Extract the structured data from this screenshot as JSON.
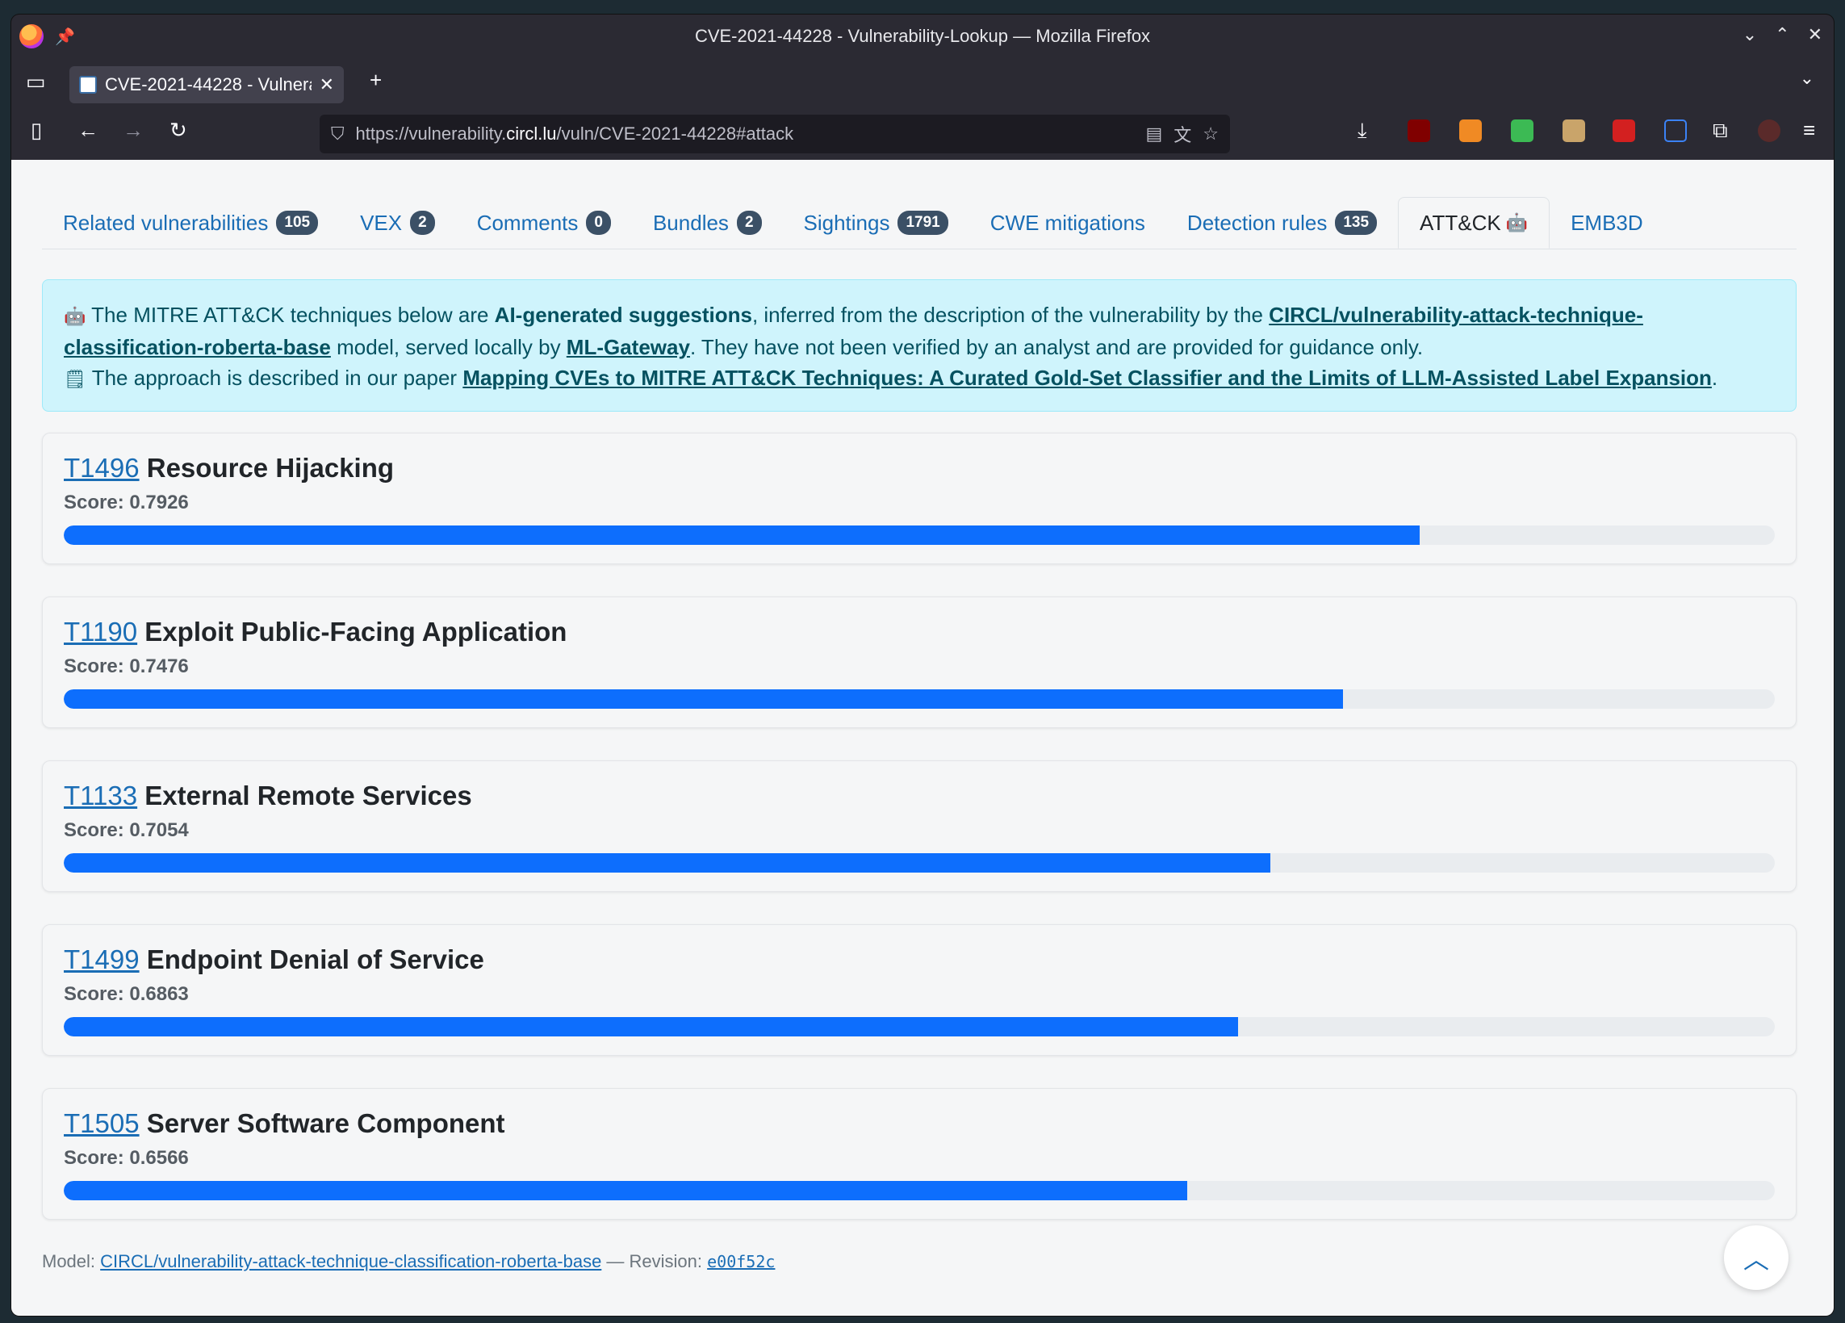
{
  "window": {
    "title": "CVE-2021-44228 - Vulnerability-Lookup — Mozilla Firefox"
  },
  "browser_tab": {
    "label": "CVE-2021-44228 - Vulnerab",
    "close": "✕",
    "new": "+"
  },
  "urlbar": {
    "prefix": "https://vulnerability.",
    "host": "circl.lu",
    "path": "/vuln/CVE-2021-44228#attack"
  },
  "page_tabs": [
    {
      "label": "Related vulnerabilities",
      "badge": "105"
    },
    {
      "label": "VEX",
      "badge": "2"
    },
    {
      "label": "Comments",
      "badge": "0"
    },
    {
      "label": "Bundles",
      "badge": "2"
    },
    {
      "label": "Sightings",
      "badge": "1791"
    },
    {
      "label": "CWE mitigations",
      "badge": ""
    },
    {
      "label": "Detection rules",
      "badge": "135"
    },
    {
      "label": "ATT&CK",
      "badge": ""
    },
    {
      "label": "EMB3D",
      "badge": ""
    }
  ],
  "alert": {
    "p1_a": "The MITRE ATT&CK techniques below are ",
    "p1_b": "AI-generated suggestions",
    "p1_c": ", inferred from the description of the vulnerability by the ",
    "p1_model": "CIRCL/vulnerability-attack-technique-classification-roberta-base",
    "p1_d": " model, served locally by ",
    "p1_gateway": "ML-Gateway",
    "p1_e": ". They have not been verified by an analyst and are provided for guidance only.",
    "p2_a": "The approach is described in our paper ",
    "p2_paper": "Mapping CVEs to MITRE ATT&CK Techniques: A Curated Gold-Set Classifier and the Limits of LLM-Assisted Label Expansion",
    "p2_b": "."
  },
  "techniques": [
    {
      "id": "T1496",
      "name": "Resource Hijacking",
      "score_text": "Score: 0.7926",
      "score": 0.7926
    },
    {
      "id": "T1190",
      "name": "Exploit Public-Facing Application",
      "score_text": "Score: 0.7476",
      "score": 0.7476
    },
    {
      "id": "T1133",
      "name": "External Remote Services",
      "score_text": "Score: 0.7054",
      "score": 0.7054
    },
    {
      "id": "T1499",
      "name": "Endpoint Denial of Service",
      "score_text": "Score: 0.6863",
      "score": 0.6863
    },
    {
      "id": "T1505",
      "name": "Server Software Component",
      "score_text": "Score: 0.6566",
      "score": 0.6566
    }
  ],
  "footer": {
    "model_label": "Model: ",
    "model": "CIRCL/vulnerability-attack-technique-classification-roberta-base",
    "sep": " — Revision: ",
    "revision": "e00f52c"
  },
  "colors": {
    "accent": "#0d6efd",
    "alert_bg": "#cff4fc",
    "link": "#1a6db5"
  },
  "icons": [
    "firefox-icon",
    "pin-icon",
    "tab-list-icon",
    "sidebar-icon",
    "back-icon",
    "forward-icon",
    "reload-icon",
    "shield-icon",
    "reader-icon",
    "translate-icon",
    "star-icon",
    "download-icon",
    "extensions-icon",
    "menu-icon",
    "robot-icon",
    "document-icon",
    "arrow-up-icon"
  ]
}
